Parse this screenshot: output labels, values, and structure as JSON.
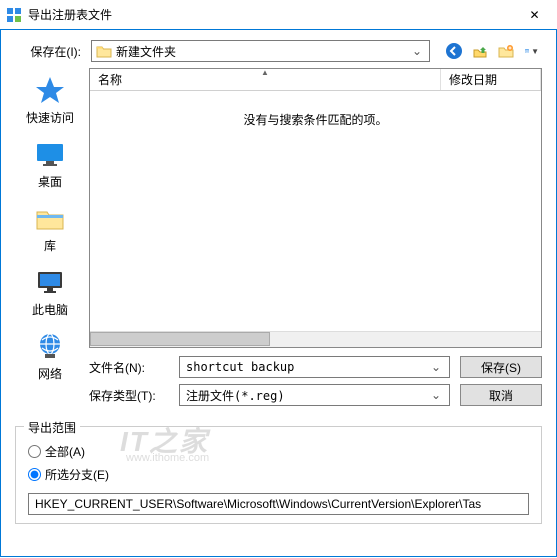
{
  "window": {
    "title": "导出注册表文件",
    "close_glyph": "✕"
  },
  "save_in": {
    "label": "保存在(I):",
    "value": "新建文件夹"
  },
  "places": {
    "quick_access": "快速访问",
    "desktop": "桌面",
    "libraries": "库",
    "this_pc": "此电脑",
    "network": "网络"
  },
  "file_list": {
    "col_name": "名称",
    "col_date": "修改日期",
    "empty_message": "没有与搜索条件匹配的项。"
  },
  "filename": {
    "label": "文件名(N):",
    "value": "shortcut backup"
  },
  "filetype": {
    "label": "保存类型(T):",
    "value": "注册文件(*.reg)"
  },
  "buttons": {
    "save": "保存(S)",
    "cancel": "取消"
  },
  "export_range": {
    "legend": "导出范围",
    "all": "全部(A)",
    "selected": "所选分支(E)",
    "path": "HKEY_CURRENT_USER\\Software\\Microsoft\\Windows\\CurrentVersion\\Explorer\\Tas"
  },
  "watermark": {
    "main": "IT之家",
    "sub": "www.ithome.com"
  }
}
